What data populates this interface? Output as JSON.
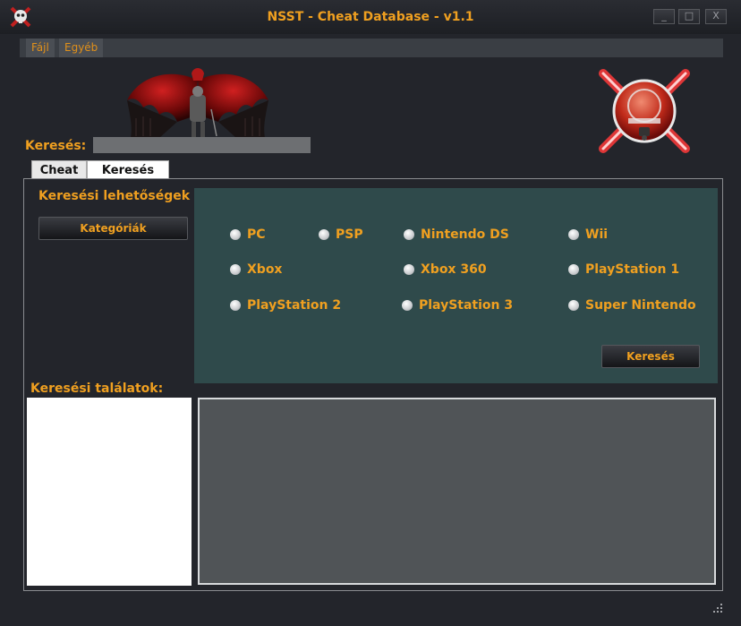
{
  "window": {
    "title": "NSST - Cheat Database - v1.1",
    "buttons": {
      "minimize": "_",
      "maximize": "□",
      "close": "X"
    }
  },
  "menu": {
    "items": [
      "Fájl",
      "Egyéb"
    ]
  },
  "search": {
    "label": "Keresés:",
    "value": "",
    "placeholder": ""
  },
  "tabs": [
    {
      "label": "Cheat",
      "active": false
    },
    {
      "label": "Keresés",
      "active": true
    }
  ],
  "options_panel": {
    "heading": "Keresési lehetőségek",
    "categories_button": "Kategóriák",
    "platforms": [
      "PC",
      "PSP",
      "Nintendo DS",
      "Wii",
      "Xbox",
      "Xbox 360",
      "PlayStation 1",
      "PlayStation 2",
      "PlayStation 3",
      "Super Nintendo"
    ],
    "search_button": "Keresés"
  },
  "results": {
    "heading": "Keresési találatok:"
  },
  "colors": {
    "accent": "#f0a020",
    "background": "#23252b",
    "options_panel": "#2f4a4b",
    "results_detail": "#505457"
  },
  "icons": [
    "app-skull-icon",
    "dragon-logo",
    "ccd-logo",
    "resize-grip-icon"
  ]
}
